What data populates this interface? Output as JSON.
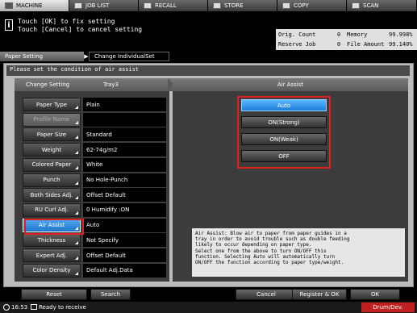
{
  "tabs": [
    {
      "label": "MACHINE",
      "active": true
    },
    {
      "label": "JOB LIST",
      "active": false
    },
    {
      "label": "RECALL",
      "active": false
    },
    {
      "label": "STORE",
      "active": false
    },
    {
      "label": "COPY",
      "active": false
    },
    {
      "label": "SCAN",
      "active": false
    }
  ],
  "message": {
    "line1": "Touch [OK] to fix setting",
    "line2": "Touch [Cancel] to cancel setting"
  },
  "counters": {
    "orig_count_label": "Orig. Count",
    "orig_count_value": "0",
    "memory_label": "Memory",
    "memory_value": "99.998%",
    "reserve_job_label": "Reserve Job",
    "reserve_job_value": "0",
    "file_amount_label": "File Amount",
    "file_amount_value": "99.140%"
  },
  "breadcrumb": {
    "item1": "Paper Setting",
    "item2": "Change IndividualSet"
  },
  "instruction": "Please set the condition of air assist",
  "left_header": {
    "title": "Change Setting",
    "tray": "Tray3"
  },
  "settings": [
    {
      "label": "Paper Type",
      "value": "Plain"
    },
    {
      "label": "Profile Name",
      "value": ""
    },
    {
      "label": "Paper Size",
      "value": "Standard"
    },
    {
      "label": "Weight",
      "value": "62-74g/m2"
    },
    {
      "label": "Colored Paper",
      "value": "White"
    },
    {
      "label": "Punch",
      "value": "No Hole-Punch"
    },
    {
      "label": "Both Sides Adj.",
      "value": "Offset Default"
    },
    {
      "label": "RU Curl Adj.",
      "value": "0   Humidify :ON"
    },
    {
      "label": "Air Assist",
      "value": "Auto"
    },
    {
      "label": "Thickness",
      "value": "Not Specify"
    },
    {
      "label": "Expert Adj.",
      "value": "Offset Default"
    },
    {
      "label": "Color Density",
      "value": "Default Adj.Data"
    }
  ],
  "right_header": "Air Assist",
  "options": [
    "Auto",
    "ON(Strong)",
    "ON(Weak)",
    "OFF"
  ],
  "selected_option": "Auto",
  "help_text": "Air Assist: Blow air to paper from paper guides in a\ntray in order to avoid trouble such as double feeding\nlikely to occur depending on paper type.\nSelect one from the above to turn ON/OFF this\nfunction. Selecting Auto will automatically turn\nON/OFF the function according to paper type/weight.",
  "bottom_buttons": {
    "reset": "Reset",
    "search": "Search",
    "cancel": "Cancel",
    "register_ok": "Register & OK",
    "ok": "OK"
  },
  "status": {
    "time": "16:53",
    "text": "Ready to receive",
    "drum": "Drum/Dev."
  },
  "colors": {
    "selected_blue": "#1e7fd8",
    "highlight_red": "#e02020",
    "panel_gray": "#bcbcbc"
  }
}
